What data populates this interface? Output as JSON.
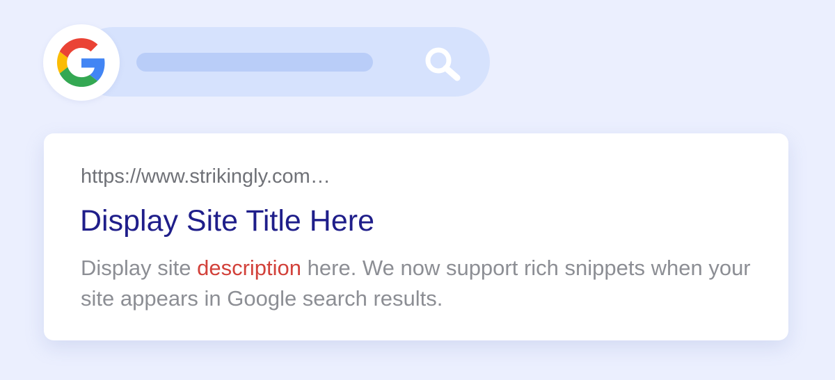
{
  "search": {
    "icon": "search-icon",
    "logo": "google-g-logo",
    "colors": {
      "bar": "#d6e2fd",
      "placeholder": "#b9cdf8",
      "icon": "#ffffff"
    }
  },
  "result": {
    "url": "https://www.strikingly.com…",
    "title": "Display Site Title Here",
    "description": {
      "before": "Display site ",
      "highlight": "description",
      "after": " here. We now support rich snippets when your site appears in Google search results."
    },
    "colors": {
      "url": "#6f7177",
      "title": "#1f1e8a",
      "description": "#8c8e94",
      "highlight": "#d2413a"
    }
  }
}
